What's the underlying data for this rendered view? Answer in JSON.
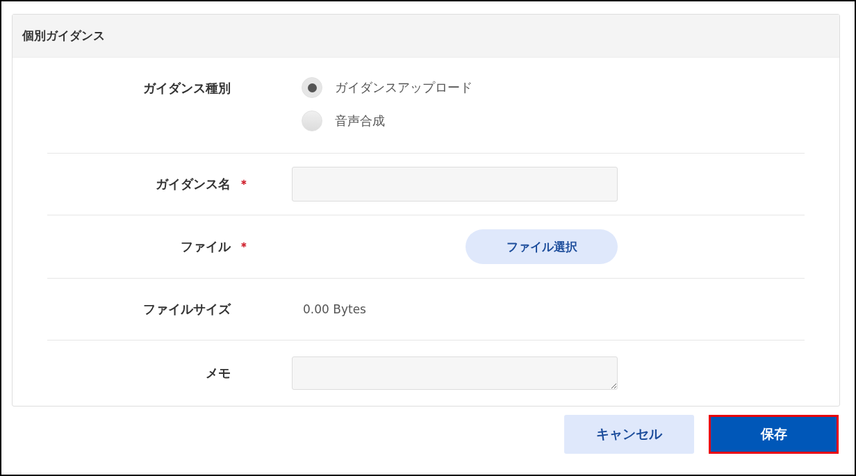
{
  "panel": {
    "title": "個別ガイダンス"
  },
  "fields": [
    {
      "kind": "radio",
      "label": "ガイダンス種別",
      "options": [
        {
          "label": "ガイダンスアップロード",
          "selected": true
        },
        {
          "label": "音声合成",
          "selected": false
        }
      ]
    },
    {
      "kind": "text",
      "label": "ガイダンス名",
      "required_mark": "＊"
    },
    {
      "kind": "file",
      "label": "ファイル",
      "required_mark": "＊",
      "button": "ファイル選択"
    },
    {
      "kind": "static",
      "label": "ファイルサイズ",
      "value": "0.00 Bytes"
    },
    {
      "kind": "textarea",
      "label": "メモ"
    }
  ],
  "buttons": [
    {
      "label": "キャンセル",
      "kind": "secondary",
      "highlighted": false
    },
    {
      "label": "保存",
      "kind": "primary",
      "highlighted": true
    }
  ]
}
